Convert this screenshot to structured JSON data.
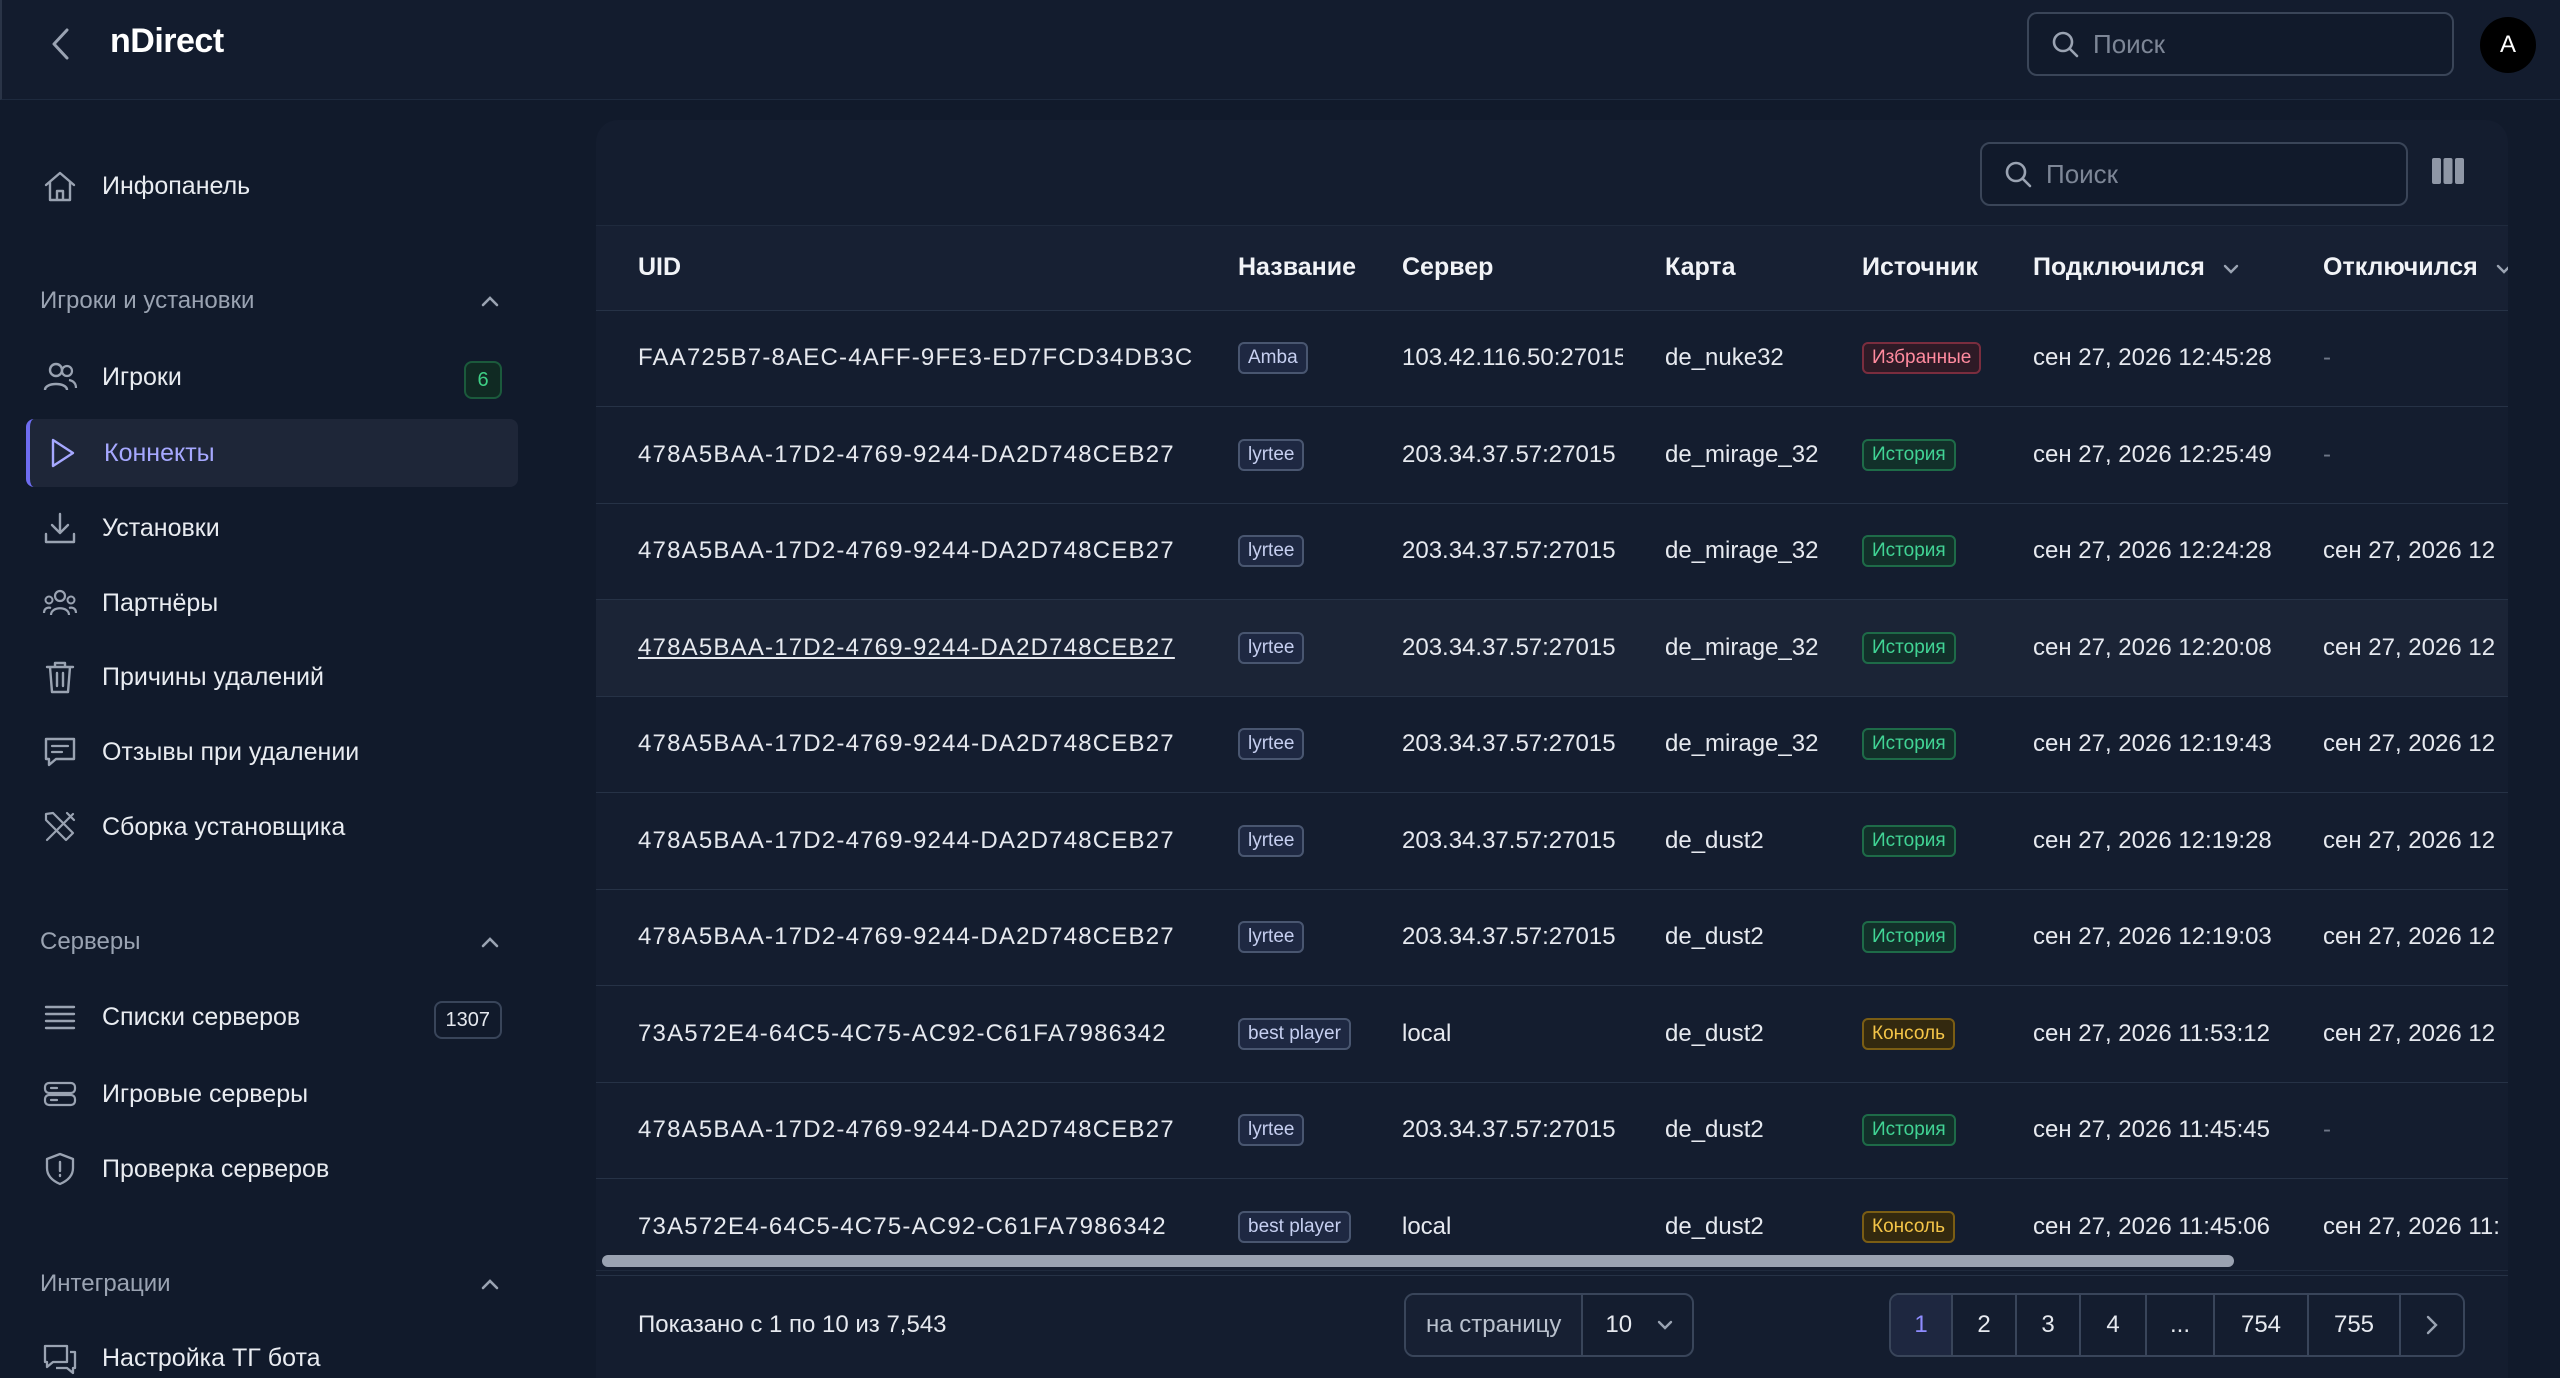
{
  "app": {
    "title": "nDirect",
    "avatar_letter": "A"
  },
  "header": {
    "search_placeholder": "Поиск"
  },
  "sidebar": {
    "dashboard": {
      "label": "Инфопанель"
    },
    "sections": {
      "players": {
        "label": "Игроки и установки"
      },
      "servers": {
        "label": "Серверы"
      },
      "integrations": {
        "label": "Интеграции"
      }
    },
    "items": {
      "players": {
        "label": "Игроки",
        "badge": "6"
      },
      "connects": {
        "label": "Коннекты"
      },
      "installs": {
        "label": "Установки"
      },
      "partners": {
        "label": "Партнёры"
      },
      "delete_reasons": {
        "label": "Причины удалений"
      },
      "delete_feedback": {
        "label": "Отзывы при удалении"
      },
      "installer_build": {
        "label": "Сборка установщика"
      },
      "server_lists": {
        "label": "Списки серверов",
        "badge": "1307"
      },
      "game_servers": {
        "label": "Игровые серверы"
      },
      "server_check": {
        "label": "Проверка серверов"
      },
      "tg_bot": {
        "label": "Настройка ТГ бота"
      }
    }
  },
  "table": {
    "search_placeholder": "Поиск",
    "columns": [
      "UID",
      "Название",
      "Сервер",
      "Карта",
      "Источник",
      "Подключился",
      "Отключился"
    ],
    "rows": [
      [
        "FAA725B7-8AEC-4AFF-9FE3-ED7FCD34DB3C",
        "Amba",
        "103.42.116.50:27015",
        "de_nuke32",
        "Избранные",
        "сен 27, 2026 12:45:28",
        "-"
      ],
      [
        "478A5BAA-17D2-4769-9244-DA2D748CEB27",
        "lyrtee",
        "203.34.37.57:27015",
        "de_mirage_32",
        "История",
        "сен 27, 2026 12:25:49",
        "-"
      ],
      [
        "478A5BAA-17D2-4769-9244-DA2D748CEB27",
        "lyrtee",
        "203.34.37.57:27015",
        "de_mirage_32",
        "История",
        "сен 27, 2026 12:24:28",
        "сен 27, 2026 12"
      ],
      [
        "478A5BAA-17D2-4769-9244-DA2D748CEB27",
        "lyrtee",
        "203.34.37.57:27015",
        "de_mirage_32",
        "История",
        "сен 27, 2026 12:20:08",
        "сен 27, 2026 12"
      ],
      [
        "478A5BAA-17D2-4769-9244-DA2D748CEB27",
        "lyrtee",
        "203.34.37.57:27015",
        "de_mirage_32",
        "История",
        "сен 27, 2026 12:19:43",
        "сен 27, 2026 12"
      ],
      [
        "478A5BAA-17D2-4769-9244-DA2D748CEB27",
        "lyrtee",
        "203.34.37.57:27015",
        "de_dust2",
        "История",
        "сен 27, 2026 12:19:28",
        "сен 27, 2026 12"
      ],
      [
        "478A5BAA-17D2-4769-9244-DA2D748CEB27",
        "lyrtee",
        "203.34.37.57:27015",
        "de_dust2",
        "История",
        "сен 27, 2026 12:19:03",
        "сен 27, 2026 12"
      ],
      [
        "73A572E4-64C5-4C75-AC92-C61FA7986342",
        "best player",
        "local",
        "de_dust2",
        "Консоль",
        "сен 27, 2026 11:53:12",
        "сен 27, 2026 12"
      ],
      [
        "478A5BAA-17D2-4769-9244-DA2D748CEB27",
        "lyrtee",
        "203.34.37.57:27015",
        "de_dust2",
        "История",
        "сен 27, 2026 11:45:45",
        "-"
      ],
      [
        "73A572E4-64C5-4C75-AC92-C61FA7986342",
        "best player",
        "local",
        "de_dust2",
        "Консоль",
        "сен 27, 2026 11:45:06",
        "сен 27, 2026 11:"
      ]
    ]
  },
  "footer": {
    "shown_text": "Показано с 1 по 10 из 7,543",
    "per_page_label": "на страницу",
    "per_page_value": "10",
    "pages": [
      "1",
      "2",
      "3",
      "4",
      "...",
      "754",
      "755"
    ]
  }
}
